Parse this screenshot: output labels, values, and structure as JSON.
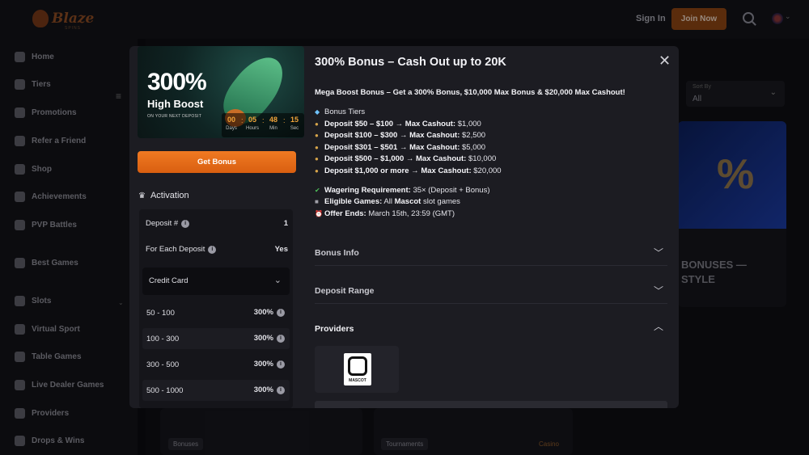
{
  "brand": {
    "logo_text": "Blaze",
    "logo_sub": "SPINS"
  },
  "header": {
    "signin": "Sign In",
    "join": "Join Now"
  },
  "sidebar": {
    "items": [
      "Home",
      "Tiers",
      "Promotions",
      "Refer a Friend",
      "Shop",
      "Achievements",
      "PVP Battles"
    ],
    "best_games": "Best Games",
    "games": [
      "Slots",
      "Virtual Sport",
      "Table Games",
      "Live Dealer Games",
      "Providers",
      "Drops & Wins"
    ]
  },
  "background": {
    "sort_label": "Sort By",
    "sort_value": "All",
    "promo_line1": "BONUSES —",
    "promo_line2": "STYLE",
    "promo_fragment": "%",
    "tags": [
      "Bonuses",
      "Tournaments",
      "Casino"
    ]
  },
  "modal": {
    "banner": {
      "big": "300%",
      "title": "High Boost",
      "subtitle": "ON YOUR NEXT DEPOSIT",
      "timer": [
        {
          "value": "00",
          "label": "Days"
        },
        {
          "value": "05",
          "label": "Hours"
        },
        {
          "value": "48",
          "label": "Min"
        },
        {
          "value": "15",
          "label": "Sec"
        }
      ]
    },
    "get_bonus": "Get Bonus",
    "activation": {
      "title": "Activation",
      "deposit_label": "Deposit #",
      "deposit_value": "1",
      "each_label": "For Each Deposit",
      "each_value": "Yes",
      "method": "Credit Card",
      "ranges": [
        {
          "range": "50 - 100",
          "pct": "300%"
        },
        {
          "range": "100 - 300",
          "pct": "300%"
        },
        {
          "range": "300 - 500",
          "pct": "300%"
        },
        {
          "range": "500 - 1000",
          "pct": "300%"
        }
      ]
    },
    "title": "300% Bonus – Cash Out up to 20K",
    "description": "Mega Boost Bonus – Get a 300% Bonus, $10,000 Max Bonus & $20,000 Max Cashout!",
    "tiers_title": "Bonus Tiers",
    "tiers": [
      {
        "deposit": "Deposit $50 – $100 → Max Cashout:",
        "max": "$1,000"
      },
      {
        "deposit": "Deposit $100 – $300 → Max Cashout:",
        "max": "$2,500"
      },
      {
        "deposit": "Deposit $301 – $501 → Max Cashout:",
        "max": "$5,000"
      },
      {
        "deposit": "Deposit $500 – $1,000 → Max Cashout:",
        "max": "$10,000"
      },
      {
        "deposit": "Deposit $1,000 or more → Max Cashout:",
        "max": "$20,000"
      }
    ],
    "wagering_label": "Wagering Requirement:",
    "wagering_value": "35× (Deposit + Bonus)",
    "games_label": "Eligible Games:",
    "games_pre": "All",
    "games_brand": "Mascot",
    "games_post": "slot games",
    "ends_label": "Offer Ends:",
    "ends_value": "March 15th, 23:59 (GMT)",
    "sections": [
      "Bonus Info",
      "Deposit Range",
      "Providers"
    ],
    "provider_name": "MASCOT"
  }
}
